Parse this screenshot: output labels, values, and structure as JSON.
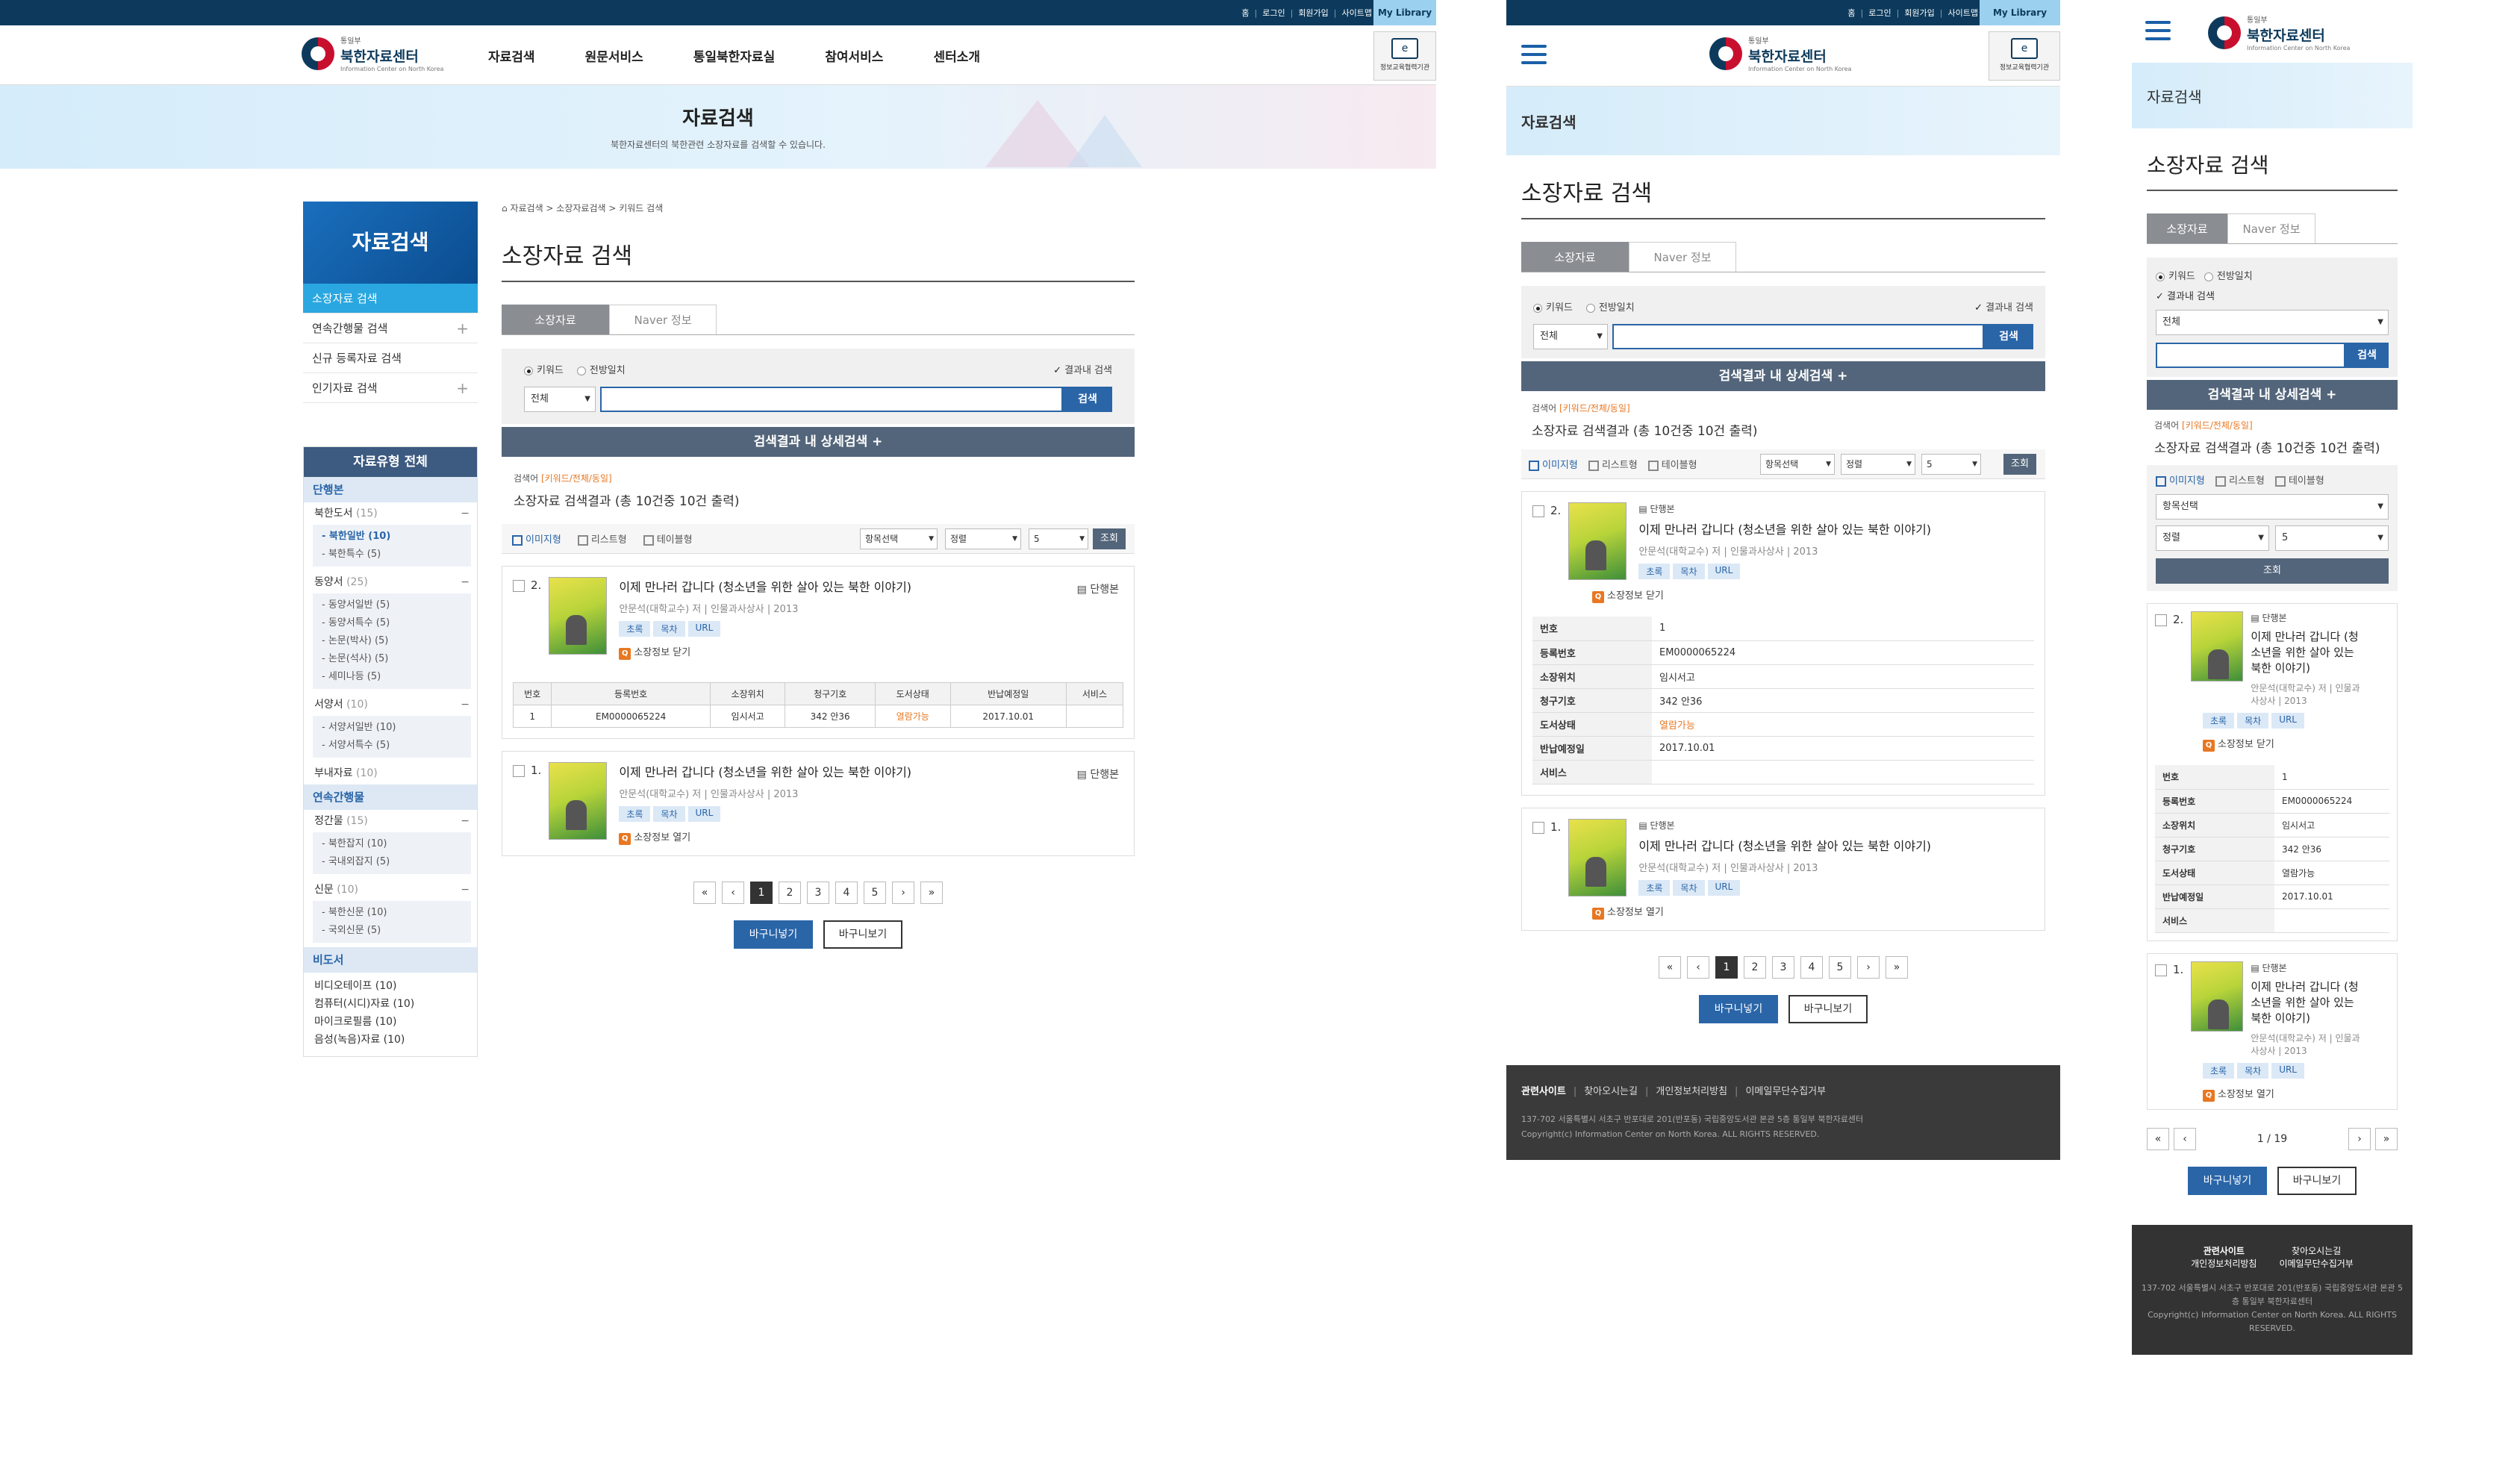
{
  "top_links": [
    "홈",
    "로그인",
    "회원가입",
    "사이트맵"
  ],
  "my_library": "My Library",
  "logo": {
    "small": "통일부",
    "main": "북한자료센터",
    "eng": "Information Center on North Korea"
  },
  "gnb": [
    "자료검색",
    "원문서비스",
    "통일북한자료실",
    "참여서비스",
    "센터소개"
  ],
  "edu_label": "정보교육협력기관",
  "visual": {
    "title": "자료검색",
    "desc": "북한자료센터의 북한관련 소장자료를 검색할 수 있습니다."
  },
  "lnb": {
    "title": "자료검색",
    "items": [
      "소장자료 검색",
      "연속간행물 검색",
      "신규 등록자료 검색",
      "인기자료 검색"
    ]
  },
  "types": {
    "title": "자료유형 전체",
    "sec1": "단행본",
    "g1": {
      "label": "북한도서",
      "count": "(15)",
      "subs": [
        "북한일반 (10)",
        "북한특수 (5)"
      ]
    },
    "g2": {
      "label": "동양서",
      "count": "(25)",
      "subs": [
        "동양서일반 (5)",
        "동양서특수 (5)",
        "논문(박사) (5)",
        "논문(석사) (5)",
        "세미나등 (5)"
      ]
    },
    "g3": {
      "label": "서양서",
      "count": "(10)",
      "subs": [
        "서양서일반 (10)",
        "서양서특수 (5)"
      ]
    },
    "g4": {
      "label": "부내자료",
      "count": "(10)"
    },
    "sec2": "연속간행물",
    "g5": {
      "label": "정간물",
      "count": "(15)",
      "subs": [
        "북한잡지 (10)",
        "국내외잡지 (5)"
      ]
    },
    "g6": {
      "label": "신문",
      "count": "(10)",
      "subs": [
        "북한신문 (10)",
        "국외신문 (5)"
      ]
    },
    "sec3": "비도서",
    "nonbook": [
      "비디오테이프 (10)",
      "컴퓨터(시디)자료 (10)",
      "마이크로필름 (10)",
      "음성(녹음)자료 (10)"
    ]
  },
  "breadcrumb": "자료검색 > 소장자료검색 > 키워드 검색",
  "page_title": "소장자료 검색",
  "tabs": [
    "소장자료",
    "Naver 정보"
  ],
  "search": {
    "radio1": "키워드",
    "radio2": "전방일치",
    "within": "결과내 검색",
    "select": "전체",
    "button": "검색",
    "advanced": "검색결과 내 상세검색  +"
  },
  "result": {
    "keyword_label": "검색어",
    "keyword_val": "[키워드/전체/동일]",
    "summary": "소장자료 검색결과 (총 10건중 10건 출력)"
  },
  "views": [
    "이미지형",
    "리스트형",
    "테이블형"
  ],
  "view_selects": [
    "항목선택",
    "정렬",
    "5"
  ],
  "view_btn": "조회",
  "items": [
    {
      "num": "2.",
      "title": "이제 만나러 갑니다 (청소년을 위한 살아 있는 북한 이야기)",
      "author": "안문석(대학교수) 저",
      "publisher": "인물과사상사",
      "year": "2013",
      "tags": [
        "초록",
        "목차",
        "URL"
      ],
      "holding": "소장정보 닫기",
      "kind": "단행본"
    },
    {
      "num": "1.",
      "title": "이제 만나러 갑니다 (청소년을 위한 살아 있는 북한 이야기)",
      "author": "안문석(대학교수) 저",
      "publisher": "인물과사상사",
      "year": "2013",
      "tags": [
        "초록",
        "목차",
        "URL"
      ],
      "holding": "소장정보 열기",
      "kind": "단행본"
    }
  ],
  "holding_table": {
    "headers": [
      "번호",
      "등록번호",
      "소장위치",
      "청구기호",
      "도서상태",
      "반납예정일",
      "서비스"
    ],
    "row": [
      "1",
      "EM0000065224",
      "임시서고",
      "342 안36",
      "열람가능",
      "2017.10.01",
      ""
    ]
  },
  "pager": [
    "«",
    "‹",
    "1",
    "2",
    "3",
    "4",
    "5",
    "›",
    "»"
  ],
  "mobile_pager": "1 / 19",
  "buttons": {
    "cart_add": "바구니넣기",
    "cart_view": "바구니보기"
  },
  "footer": {
    "links": [
      "관련사이트",
      "찾아오시는길",
      "개인정보처리방침",
      "이메일무단수집거부"
    ],
    "addr": "137-702 서울특별시 서초구 반포대로 201(반포동) 국립중앙도서관 본관 5층 통일부 북한자료센터",
    "copy": "Copyright(c) Information Center on North Korea. ALL RIGHTS RESERVED."
  }
}
